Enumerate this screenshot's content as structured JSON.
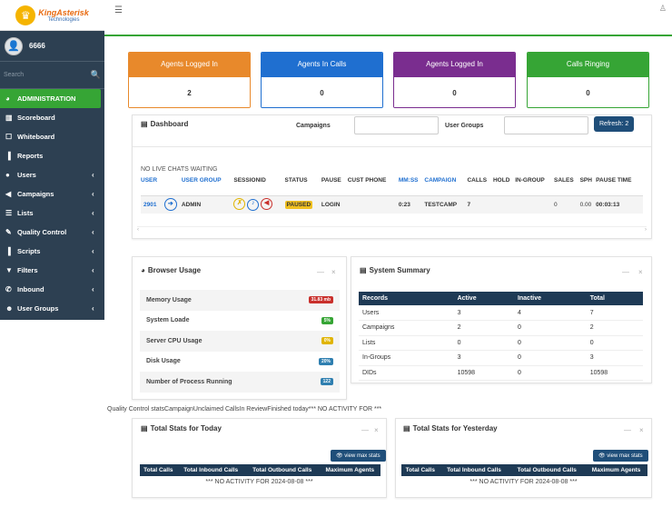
{
  "logo": {
    "line1": "KingAsterisk",
    "line2": "Technologies"
  },
  "user": {
    "name": "6666"
  },
  "search": {
    "placeholder": "Search"
  },
  "nav": [
    {
      "label": "ADMINISTRATION",
      "icon": "dashboard-icon",
      "chevron": ""
    },
    {
      "label": "Scoreboard",
      "icon": "bar-chart-icon",
      "chevron": ""
    },
    {
      "label": "Whiteboard",
      "icon": "square-icon",
      "chevron": ""
    },
    {
      "label": "Reports",
      "icon": "document-icon",
      "chevron": ""
    },
    {
      "label": "Users",
      "icon": "user-icon",
      "chevron": "‹"
    },
    {
      "label": "Campaigns",
      "icon": "megaphone-icon",
      "chevron": "‹"
    },
    {
      "label": "Lists",
      "icon": "list-icon",
      "chevron": "‹"
    },
    {
      "label": "Quality Control",
      "icon": "edit-icon",
      "chevron": "‹"
    },
    {
      "label": "Scripts",
      "icon": "file-icon",
      "chevron": "‹"
    },
    {
      "label": "Filters",
      "icon": "filter-icon",
      "chevron": "‹"
    },
    {
      "label": "Inbound",
      "icon": "phone-icon",
      "chevron": "‹"
    },
    {
      "label": "User Groups",
      "icon": "users-icon",
      "chevron": "‹"
    }
  ],
  "cards": [
    {
      "title": "Agents Logged In",
      "value": "2",
      "color": "#e8892b"
    },
    {
      "title": "Agents In Calls",
      "value": "0",
      "color": "#1f6fd0"
    },
    {
      "title": "Agents Logged In",
      "value": "0",
      "color": "#7a2d8f"
    },
    {
      "title": "Calls Ringing",
      "value": "0",
      "color": "#36a535"
    }
  ],
  "dashboard": {
    "title": "Dashboard",
    "campaigns_label": "Campaigns",
    "groups_label": "User Groups",
    "refresh": "Refresh: 2",
    "no_chats": "NO LIVE CHATS WAITING",
    "headers": [
      "USER",
      "USER GROUP",
      "SESSIONID",
      "STATUS",
      "PAUSE",
      "CUST PHONE",
      "MM:SS",
      "CAMPAIGN",
      "CALLS",
      "HOLD",
      "IN-GROUP",
      "SALES",
      "SPH",
      "PAUSE TIME"
    ],
    "row": {
      "user": "2901",
      "group": "ADMIN",
      "status": "PAUSED",
      "pause": "LOGIN",
      "mmss": "0:23",
      "campaign": "TESTCAMP",
      "calls": "7",
      "sales": "0",
      "sph": "0.00",
      "pausetime": "00:03:13"
    }
  },
  "browser": {
    "title": "Browser Usage",
    "rows": [
      {
        "label": "Memory Usage",
        "badge": "31.83 mb",
        "color": "#c9302c"
      },
      {
        "label": "System Loade",
        "badge": "5%",
        "color": "#36a535"
      },
      {
        "label": "Server CPU Usage",
        "badge": "0%",
        "color": "#e0b400"
      },
      {
        "label": "Disk Usage",
        "badge": "20%",
        "color": "#2f7fb0"
      },
      {
        "label": "Number of Process Running",
        "badge": "122",
        "color": "#2f7fb0"
      }
    ]
  },
  "summary": {
    "title": "System Summary",
    "headers": [
      "Records",
      "Active",
      "Inactive",
      "Total"
    ],
    "rows": [
      [
        "Users",
        "3",
        "4",
        "7"
      ],
      [
        "Campaigns",
        "2",
        "0",
        "2"
      ],
      [
        "Lists",
        "0",
        "0",
        "0"
      ],
      [
        "In-Groups",
        "3",
        "0",
        "3"
      ],
      [
        "DIDs",
        "10598",
        "0",
        "10598"
      ]
    ]
  },
  "qc_line": "Quality Control statsCampaignUnclaimed CallsIn ReviewFinished today*** NO ACTIVITY FOR  ***",
  "today": {
    "title": "Total Stats for Today",
    "button": "view max stats",
    "headers": [
      "Total Calls",
      "Total Inbound Calls",
      "Total Outbound Calls",
      "Maximum Agents"
    ],
    "note": "*** NO ACTIVITY FOR  2024-08-08 ***"
  },
  "yesterday": {
    "title": "Total Stats for Yesterday",
    "button": "view max stats",
    "headers": [
      "Total Calls",
      "Total Inbound Calls",
      "Total Outbound Calls",
      "Maximum Agents"
    ],
    "note": "*** NO ACTIVITY FOR 2024-08-08 ***"
  }
}
